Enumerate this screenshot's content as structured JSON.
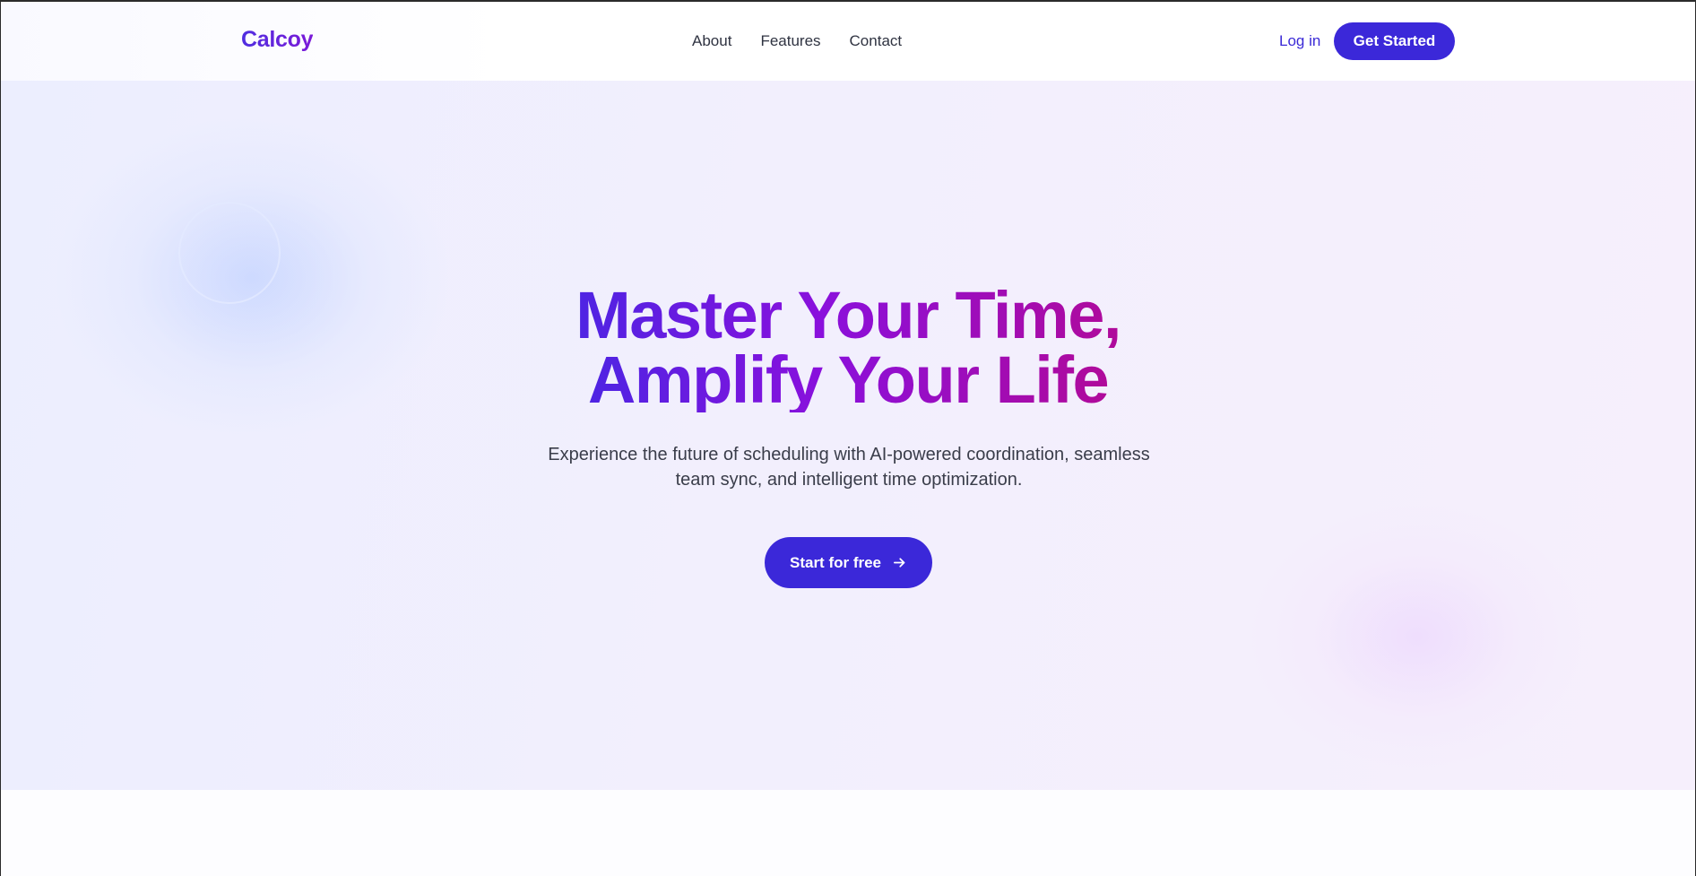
{
  "header": {
    "logo": "Calcoy",
    "nav": [
      "About",
      "Features",
      "Contact"
    ],
    "login_label": "Log in",
    "get_started_label": "Get Started"
  },
  "hero": {
    "headline_line1": "Master Your Time,",
    "headline_line2": "Amplify Your Life",
    "subtitle_line1": "Experience the future of scheduling with AI-powered coordination, seamless",
    "subtitle_line2": "team sync, and intelligent time optimization.",
    "cta_label": "Start for free",
    "cta_icon": "arrow-right-icon"
  },
  "colors": {
    "accent": "#3b28d9",
    "gradient_start": "#4e24e3",
    "gradient_mid": "#8a10dc",
    "gradient_end": "#b00a9a"
  }
}
